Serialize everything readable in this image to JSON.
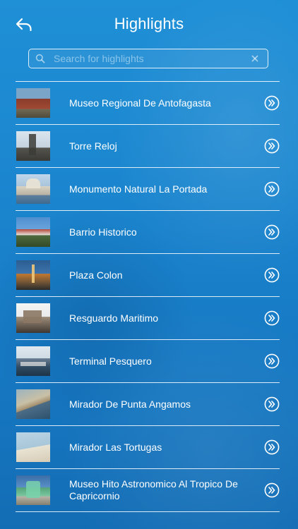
{
  "header": {
    "title": "Highlights"
  },
  "search": {
    "placeholder": "Search for highlights",
    "value": ""
  },
  "items": [
    {
      "label": "Museo Regional De Antofagasta"
    },
    {
      "label": "Torre Reloj"
    },
    {
      "label": "Monumento Natural La Portada"
    },
    {
      "label": "Barrio Historico"
    },
    {
      "label": "Plaza Colon"
    },
    {
      "label": "Resguardo Maritimo"
    },
    {
      "label": "Terminal Pesquero"
    },
    {
      "label": "Mirador De Punta Angamos"
    },
    {
      "label": "Mirador Las Tortugas"
    },
    {
      "label": "Museo Hito Astronomico Al Tropico De Capricornio"
    }
  ],
  "icons": {
    "back": "back-arrow-icon",
    "search": "search-icon",
    "clear": "clear-icon",
    "row_action": "double-chevron-right-circle-icon"
  },
  "colors": {
    "background": "#1b86cf",
    "foreground": "#ffffff"
  }
}
